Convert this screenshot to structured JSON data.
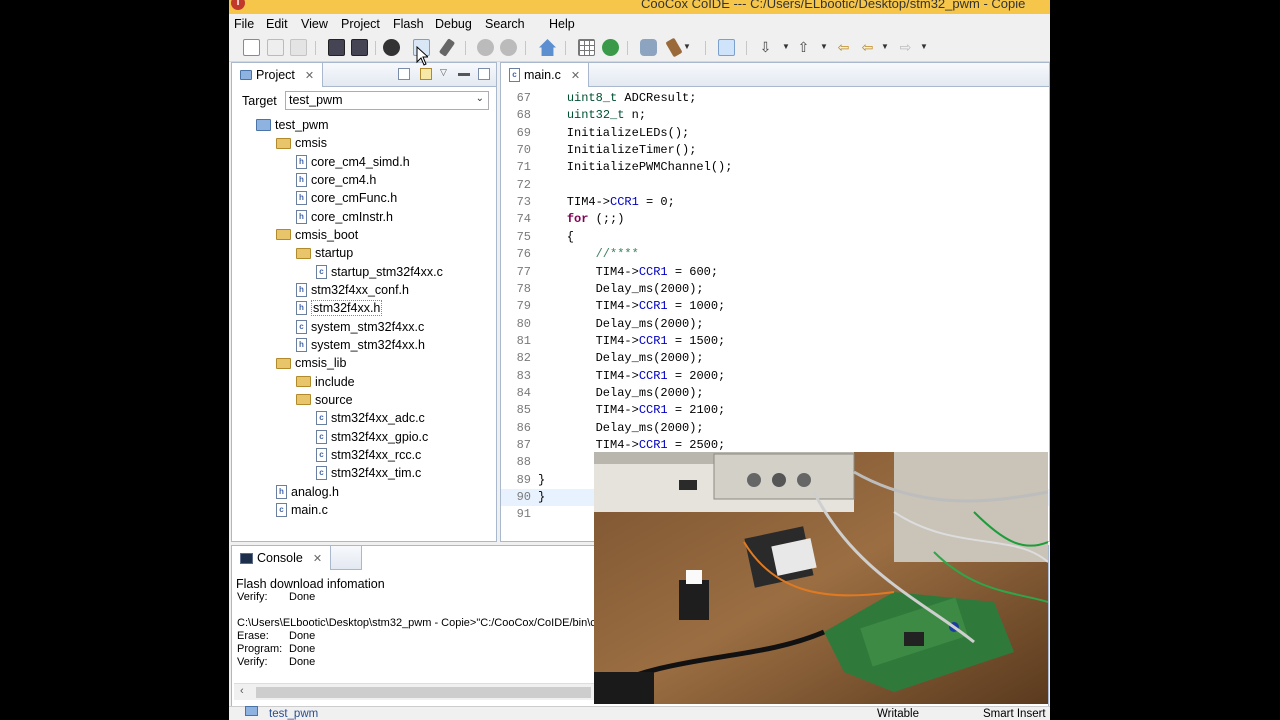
{
  "window": {
    "title": "CooCox CoIDE --- C:/Users/ELbootic/Desktop/stm32_pwm - Copie"
  },
  "menu": [
    "File",
    "Edit",
    "View",
    "Project",
    "Flash",
    "Debug",
    "Search",
    "Help"
  ],
  "project_view": {
    "tab_label": "Project",
    "target_label": "Target",
    "target_value": "test_pwm",
    "tree": [
      {
        "label": "test_pwm",
        "kind": "project",
        "depth": 0
      },
      {
        "label": "cmsis",
        "kind": "folder",
        "depth": 1
      },
      {
        "label": "core_cm4_simd.h",
        "kind": "file",
        "depth": 2
      },
      {
        "label": "core_cm4.h",
        "kind": "file",
        "depth": 2
      },
      {
        "label": "core_cmFunc.h",
        "kind": "file",
        "depth": 2
      },
      {
        "label": "core_cmInstr.h",
        "kind": "file",
        "depth": 2
      },
      {
        "label": "cmsis_boot",
        "kind": "folder",
        "depth": 1
      },
      {
        "label": "startup",
        "kind": "folder",
        "depth": 2
      },
      {
        "label": "startup_stm32f4xx.c",
        "kind": "file",
        "depth": 3
      },
      {
        "label": "stm32f4xx_conf.h",
        "kind": "file",
        "depth": 2
      },
      {
        "label": "stm32f4xx.h",
        "kind": "file",
        "depth": 2,
        "selected": true
      },
      {
        "label": "system_stm32f4xx.c",
        "kind": "file",
        "depth": 2
      },
      {
        "label": "system_stm32f4xx.h",
        "kind": "file",
        "depth": 2
      },
      {
        "label": "cmsis_lib",
        "kind": "folder",
        "depth": 1
      },
      {
        "label": "include",
        "kind": "folder",
        "depth": 2
      },
      {
        "label": "source",
        "kind": "folder",
        "depth": 2
      },
      {
        "label": "stm32f4xx_adc.c",
        "kind": "file",
        "depth": 3
      },
      {
        "label": "stm32f4xx_gpio.c",
        "kind": "file",
        "depth": 3
      },
      {
        "label": "stm32f4xx_rcc.c",
        "kind": "file",
        "depth": 3
      },
      {
        "label": "stm32f4xx_tim.c",
        "kind": "file",
        "depth": 3
      },
      {
        "label": "analog.h",
        "kind": "file",
        "depth": 1
      },
      {
        "label": "main.c",
        "kind": "file",
        "depth": 1
      }
    ]
  },
  "editor": {
    "tab_label": "main.c",
    "lines": [
      {
        "n": "67",
        "code": "    uint8_t ADCResult;"
      },
      {
        "n": "68",
        "code": "    uint32_t n;"
      },
      {
        "n": "69",
        "code": "    InitializeLEDs();"
      },
      {
        "n": "70",
        "code": "    InitializeTimer();"
      },
      {
        "n": "71",
        "code": "    InitializePWMChannel();"
      },
      {
        "n": "72",
        "code": ""
      },
      {
        "n": "73",
        "code": "    TIM4->CCR1 = 0;"
      },
      {
        "n": "74",
        "code": "    for (;;)"
      },
      {
        "n": "75",
        "code": "    {"
      },
      {
        "n": "76",
        "code": "        //****"
      },
      {
        "n": "77",
        "code": "        TIM4->CCR1 = 600;"
      },
      {
        "n": "78",
        "code": "        Delay_ms(2000);"
      },
      {
        "n": "79",
        "code": "        TIM4->CCR1 = 1000;"
      },
      {
        "n": "80",
        "code": "        Delay_ms(2000);"
      },
      {
        "n": "81",
        "code": "        TIM4->CCR1 = 1500;"
      },
      {
        "n": "82",
        "code": "        Delay_ms(2000);"
      },
      {
        "n": "83",
        "code": "        TIM4->CCR1 = 2000;"
      },
      {
        "n": "84",
        "code": "        Delay_ms(2000);"
      },
      {
        "n": "85",
        "code": "        TIM4->CCR1 = 2100;"
      },
      {
        "n": "86",
        "code": "        Delay_ms(2000);"
      },
      {
        "n": "87",
        "code": "        TIM4->CCR1 = 2500;"
      },
      {
        "n": "88",
        "code": ""
      },
      {
        "n": "89",
        "code": "}"
      },
      {
        "n": "90",
        "code": "}"
      },
      {
        "n": "91",
        "code": ""
      }
    ]
  },
  "console": {
    "tab_label": "Console",
    "header": "Flash download infomation",
    "lines": [
      {
        "label": "Verify:",
        "value": "Done"
      },
      {
        "label": "",
        "value": ""
      },
      {
        "label": "C:\\Users\\ELbootic\\Desktop\\stm32_pwm - Copie>\"C:/CooCox/CoIDE/bin\\c",
        "value": ""
      },
      {
        "label": "Erase:",
        "value": "Done"
      },
      {
        "label": "Program:",
        "value": "Done"
      },
      {
        "label": "Verify:",
        "value": "Done"
      }
    ]
  },
  "statusbar": {
    "project": "test_pwm",
    "writable": "Writable",
    "insert_mode": "Smart Insert"
  },
  "colors": {
    "titlebar": "#f5c64a",
    "keyword": "#7f0055",
    "field": "#0000c0",
    "comment": "#3f7f5f",
    "type": "#005032"
  }
}
